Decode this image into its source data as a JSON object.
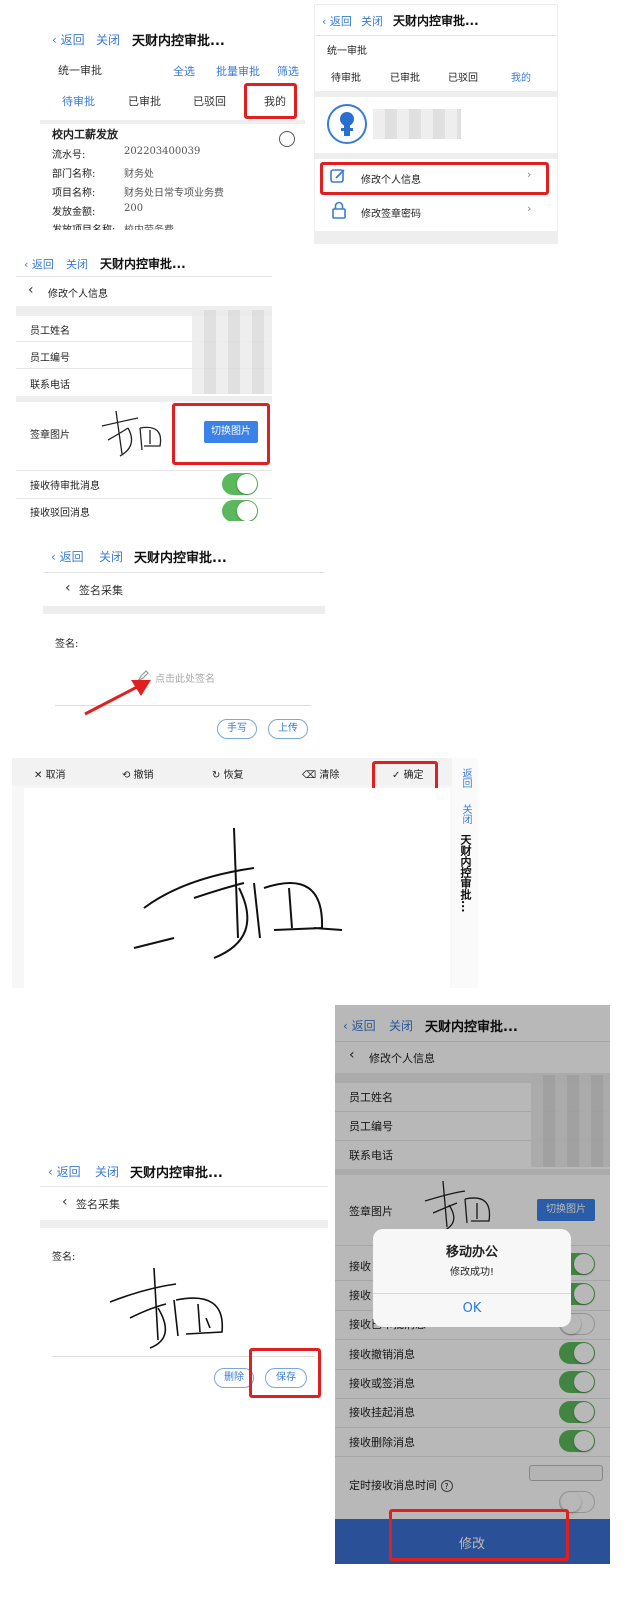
{
  "nav": {
    "back": "返回",
    "close": "关闭",
    "title": "天财内控审批..."
  },
  "panel1": {
    "section_label": "统一审批",
    "actions": [
      "全选",
      "批量审批",
      "筛选"
    ],
    "tabs": [
      "待审批",
      "已审批",
      "已驳回",
      "我的"
    ],
    "item_title": "校内工薪发放",
    "fields": [
      {
        "label": "流水号:",
        "value": "202203400039"
      },
      {
        "label": "部门名称:",
        "value": "财务处"
      },
      {
        "label": "项目名称:",
        "value": "财务处日常专项业务费"
      },
      {
        "label": "发放金额:",
        "value": "200"
      },
      {
        "label": "发放项目名称:",
        "value": "校内劳务费"
      }
    ]
  },
  "panel2": {
    "section_label": "统一审批",
    "tabs": [
      "待审批",
      "已审批",
      "已驳回",
      "我的"
    ],
    "menu": [
      {
        "icon": "edit-icon",
        "label": "修改个人信息"
      },
      {
        "icon": "lock-icon",
        "label": "修改签章密码"
      }
    ]
  },
  "panel3": {
    "subtitle": "修改个人信息",
    "rows": [
      "员工姓名",
      "员工编号",
      "联系电话"
    ],
    "sign_label": "签章图片",
    "switch_button": "切换图片",
    "toggle_rows": [
      "接收待审批消息",
      "接收驳回消息"
    ]
  },
  "panel4": {
    "subtitle": "签名采集",
    "sign_label": "签名:",
    "placeholder": "点击此处签名",
    "btn_handwrite": "手写",
    "btn_upload": "上传"
  },
  "panel5": {
    "toolbar": [
      "取消",
      "撤销",
      "恢复",
      "清除",
      "确定"
    ],
    "side_back": "返回",
    "side_close": "关闭",
    "side_title": "天财内控审批..."
  },
  "panel6": {
    "subtitle": "签名采集",
    "sign_label": "签名:",
    "btn_delete": "删除",
    "btn_save": "保存"
  },
  "panel7": {
    "subtitle": "修改个人信息",
    "rows": [
      "员工姓名",
      "员工编号",
      "联系电话"
    ],
    "sign_label": "签章图片",
    "switch_button": "切换图片",
    "toggle_rows": [
      {
        "label": "接收",
        "on": true
      },
      {
        "label": "接收",
        "on": true
      },
      {
        "label": "接收已审批消息",
        "on": false
      },
      {
        "label": "接收撤销消息",
        "on": true
      },
      {
        "label": "接收或签消息",
        "on": true
      },
      {
        "label": "接收挂起消息",
        "on": true
      },
      {
        "label": "接收删除消息",
        "on": true
      }
    ],
    "timer_label": "定时接收消息时间",
    "submit": "修改",
    "dialog": {
      "title": "移动办公",
      "message": "修改成功!",
      "ok": "OK"
    }
  },
  "colors": {
    "accent": "#3a7bd5",
    "highlight": "#e02020",
    "toggle_on": "#5cb85c",
    "submit_bg": "#3b6fd1"
  }
}
